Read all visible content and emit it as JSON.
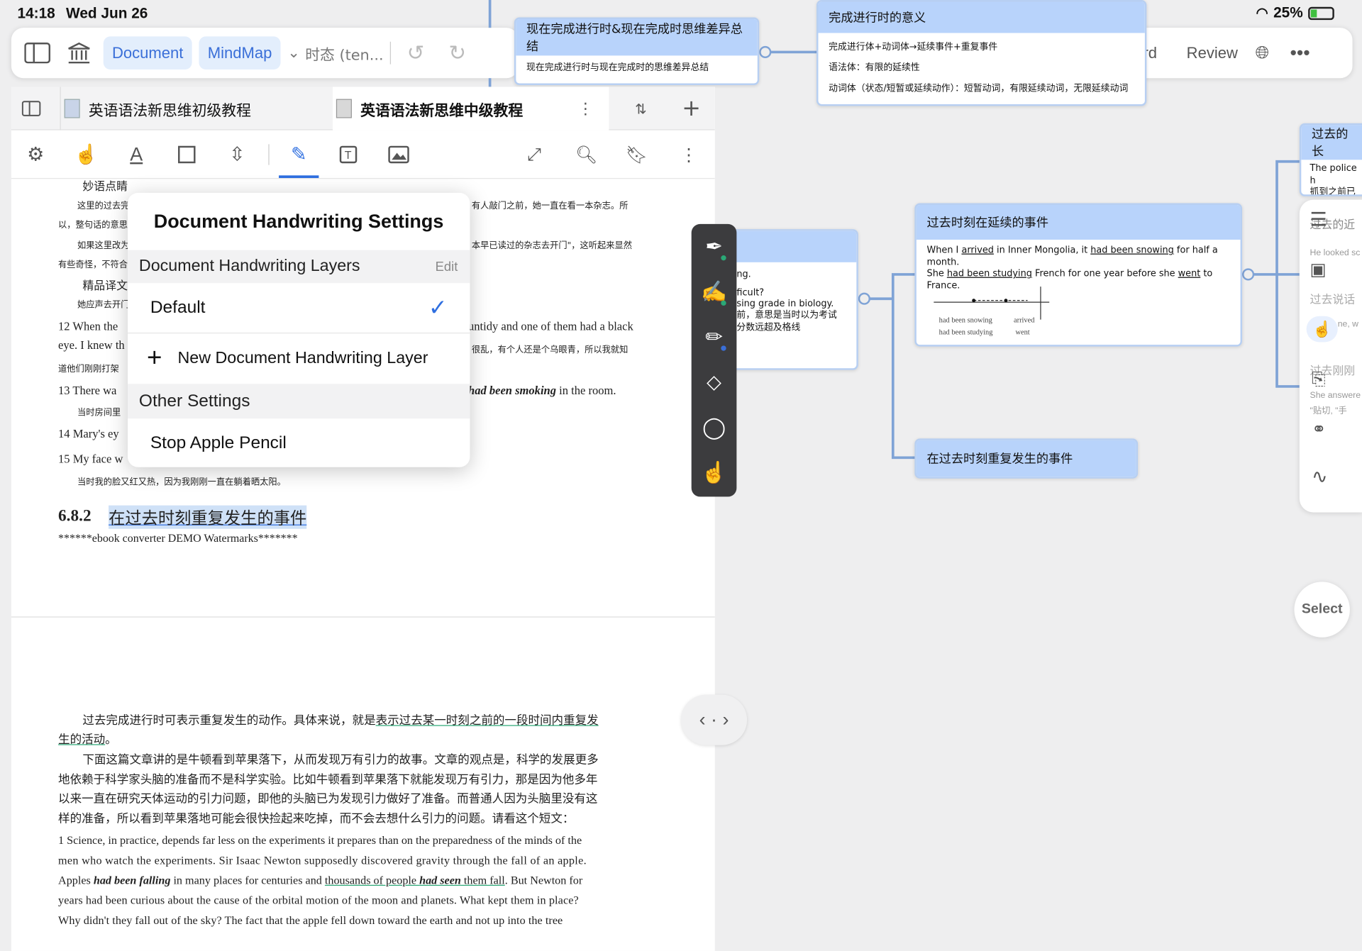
{
  "status": {
    "time": "14:18",
    "date": "Wed Jun 26",
    "battery": "25%"
  },
  "topbar": {
    "document": "Document",
    "mindmap": "MindMap",
    "breadcrumb": "时态 (ten..."
  },
  "rightbar": {
    "card": "Card",
    "review": "Review"
  },
  "tabs": [
    {
      "label": "英语语法新思维初级教程"
    },
    {
      "label": "英语语法新思维中级教程"
    }
  ],
  "popup": {
    "title": "Document Handwriting Settings",
    "section1": "Document Handwriting Layers",
    "edit": "Edit",
    "default_layer": "Default",
    "new_layer": "New Document Handwriting Layer",
    "section2": "Other Settings",
    "stop_pencil": "Stop Apple Pencil"
  },
  "doc": {
    "miaoyu": "妙语点睛",
    "line1a": "这里的过去完",
    "line1b": "有人敲门之前，她一直在看一本杂志。所",
    "line2": "以，整句话的意思",
    "line3a": "如果这里改为",
    "line3b": "本早已读过的杂志去开门\"，这听起来显然",
    "line4": "有些奇怪，不符合",
    "jingpin": "精品译文",
    "line5": "她应声去开门",
    "s12a": "12   When the",
    "s12b": "untidy and one of them had a black",
    "s12c": "eye. I knew th",
    "s12d": "很乱，有个人还是个乌眼青，所以我就知",
    "s12e": "道他们刚刚打架",
    "s13a": "13   There wa",
    "s13b": "had been smoking",
    "s13c": " in the room.",
    "s13d": "当时房间里",
    "s14": "14   Mary's ey",
    "s15a": "15   My face w",
    "s15b": "当时我的脸又红又热，因为我刚刚一直在躺着晒太阳。",
    "sec_num": "6.8.2",
    "sec_title": "在过去时刻重复发生的事件",
    "watermark": "******ebook converter DEMO Watermarks*******",
    "p1a": "过去完成进行时可表示重复发生的动作。具体来说，就是",
    "p1b": "表示过去某一时刻之前的一段时间内重复发",
    "p1c": "生的活动",
    "p1d": "。",
    "p2a": "下面这篇文章讲的是牛顿看到苹果落下，从而发现万有引力的故事。文章的观点是，科学的发展更多",
    "p2b": "地依赖于科学家头脑的准备而不是科学实验。比如牛顿看到苹果落下就能发现万有引力，那是因为他多年",
    "p2c": "以来一直在研究天体运动的引力问题，即他的头脑已为发现引力做好了准备。而普通人因为头脑里没有这",
    "p2d": "样的准备，所以看到苹果落地可能会很快捡起来吃掉，而不会去想什么引力的问题。请看这个短文：",
    "e1": "1   Science, in practice, depends far less on the experiments it prepares than on the preparedness of the minds of the",
    "e2": "men who watch the experiments. Sir Isaac Newton supposedly discovered gravity through the fall of an apple.",
    "e3a": "Apples ",
    "e3b": "had been falling",
    "e3c": " in many places for centuries and ",
    "e3d": "thousands of people ",
    "e3e": "had seen",
    "e3f": " them fall",
    "e3g": ". But Newton for",
    "e4": "years had been curious about the cause of the orbital motion of the moon and planets. What kept them in place?",
    "e5": "Why didn't they fall out of the sky? The fact that the apple fell down toward the earth and not up into the tree"
  },
  "mindmap": {
    "n1_title": "现在完成进行时&现在完成时思维差异总结",
    "n1_body": "现在完成进行时与现在完成时的思维差异总结",
    "n2_title": "完成进行时的意义",
    "n2_l1": "完成进行体+动词体→延续事件+重复事件",
    "n2_l2": "语法体：有限的延续性",
    "n2_l3": "动词体（状态/短暂或延续动作）：短暂动词，有限延续动词，无限延续动词",
    "n3_l1": "ng.",
    "n3_l2": "ficult?",
    "n3_l3": "sing grade in biology.",
    "n3_l4": "前，意思是当时以为考试",
    "n3_l5": "分数远超及格线",
    "n4_title": "过去时刻在延续的事件",
    "n4_l1a": "When I ",
    "n4_l1b": "arrived",
    "n4_l1c": " in Inner Mongolia, it ",
    "n4_l1d": "had been snowing",
    "n4_l1e": " for half a month.",
    "n4_l2a": "She ",
    "n4_l2b": "had been studying",
    "n4_l2c": " French for one year before she ",
    "n4_l2d": "went",
    "n4_l2e": " to France.",
    "n4_d1": "had been snowing",
    "n4_d2": "had been studying",
    "n4_d3": "arrived",
    "n4_d4": "went",
    "n5_title": "在过去时刻重复发生的事件",
    "n6_title": "过去的长",
    "n6_l1": "The police h",
    "n6_l2": "抓到之前已经",
    "side_l1": "过去的近",
    "side_l2": "He looked sc",
    "side_l3": "过去说话",
    "side_l4": "ne, w",
    "side_l5": "过去刚刚",
    "side_l6": "She answere",
    "side_l7": "\"贴切, \"手",
    "select": "Select"
  }
}
